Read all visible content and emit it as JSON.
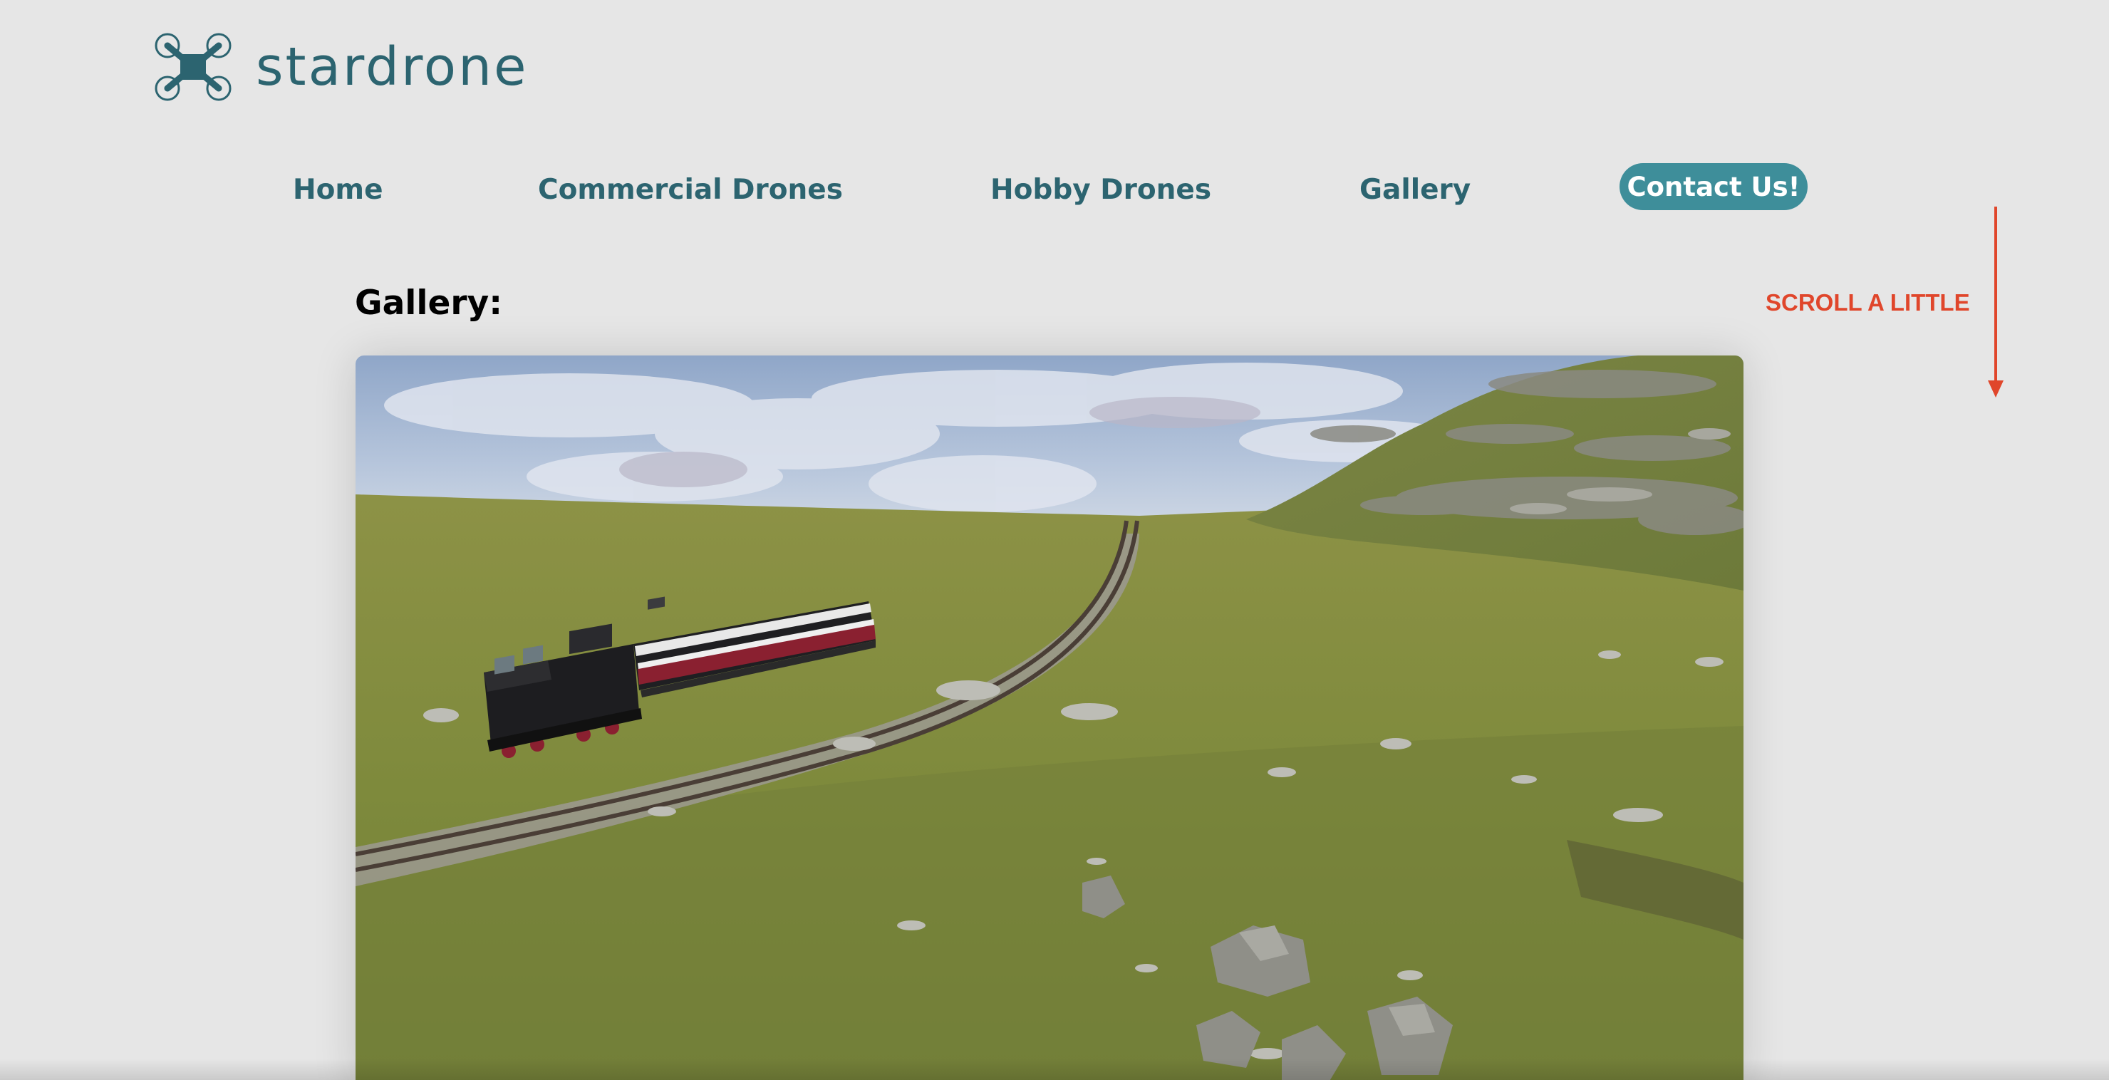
{
  "brand": {
    "name": "stardrone",
    "logo_icon": "drone-icon",
    "color": "#2c6470"
  },
  "nav": {
    "items": [
      {
        "label": "Home"
      },
      {
        "label": "Commercial Drones"
      },
      {
        "label": "Hobby Drones"
      },
      {
        "label": "Gallery"
      }
    ],
    "contact_label": "Contact Us!",
    "contact_color": "#3e8e9a"
  },
  "gallery": {
    "title": "Gallery:"
  },
  "scroll_hint": {
    "label": "SCROLL A LITTLE",
    "color": "#e0462b",
    "icon": "arrow-down-icon"
  }
}
